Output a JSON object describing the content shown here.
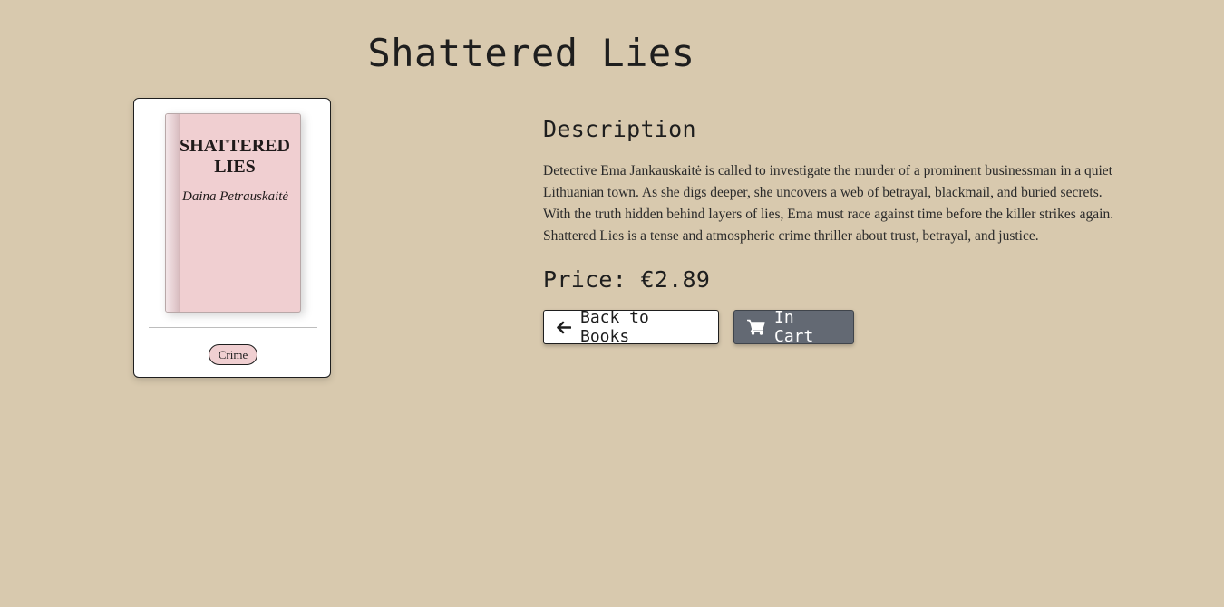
{
  "book": {
    "title": "Shattered Lies",
    "cover_title": "Shattered Lies",
    "cover_author": "Daina Petrauskaitė",
    "genre": "Crime",
    "cover_color": "#f0cfd1"
  },
  "description": {
    "heading": "Description",
    "text": "Detective Ema Jankauskaitė is called to investigate the murder of a prominent businessman in a quiet Lithuanian town. As she digs deeper, she uncovers a web of betrayal, blackmail, and buried secrets. With the truth hidden behind layers of lies, Ema must race against time before the killer strikes again. Shattered Lies is a tense and atmospheric crime thriller about trust, betrayal, and justice."
  },
  "price": {
    "label": "Price:",
    "value": "€2.89"
  },
  "actions": {
    "back_label": "Back to Books",
    "back_icon": "arrow-left-icon",
    "cart_label": "In Cart",
    "cart_icon": "shopping-cart-icon"
  },
  "colors": {
    "background": "#d8c9ae",
    "cart_button": "#636973",
    "badge": "#f0cfd1"
  }
}
